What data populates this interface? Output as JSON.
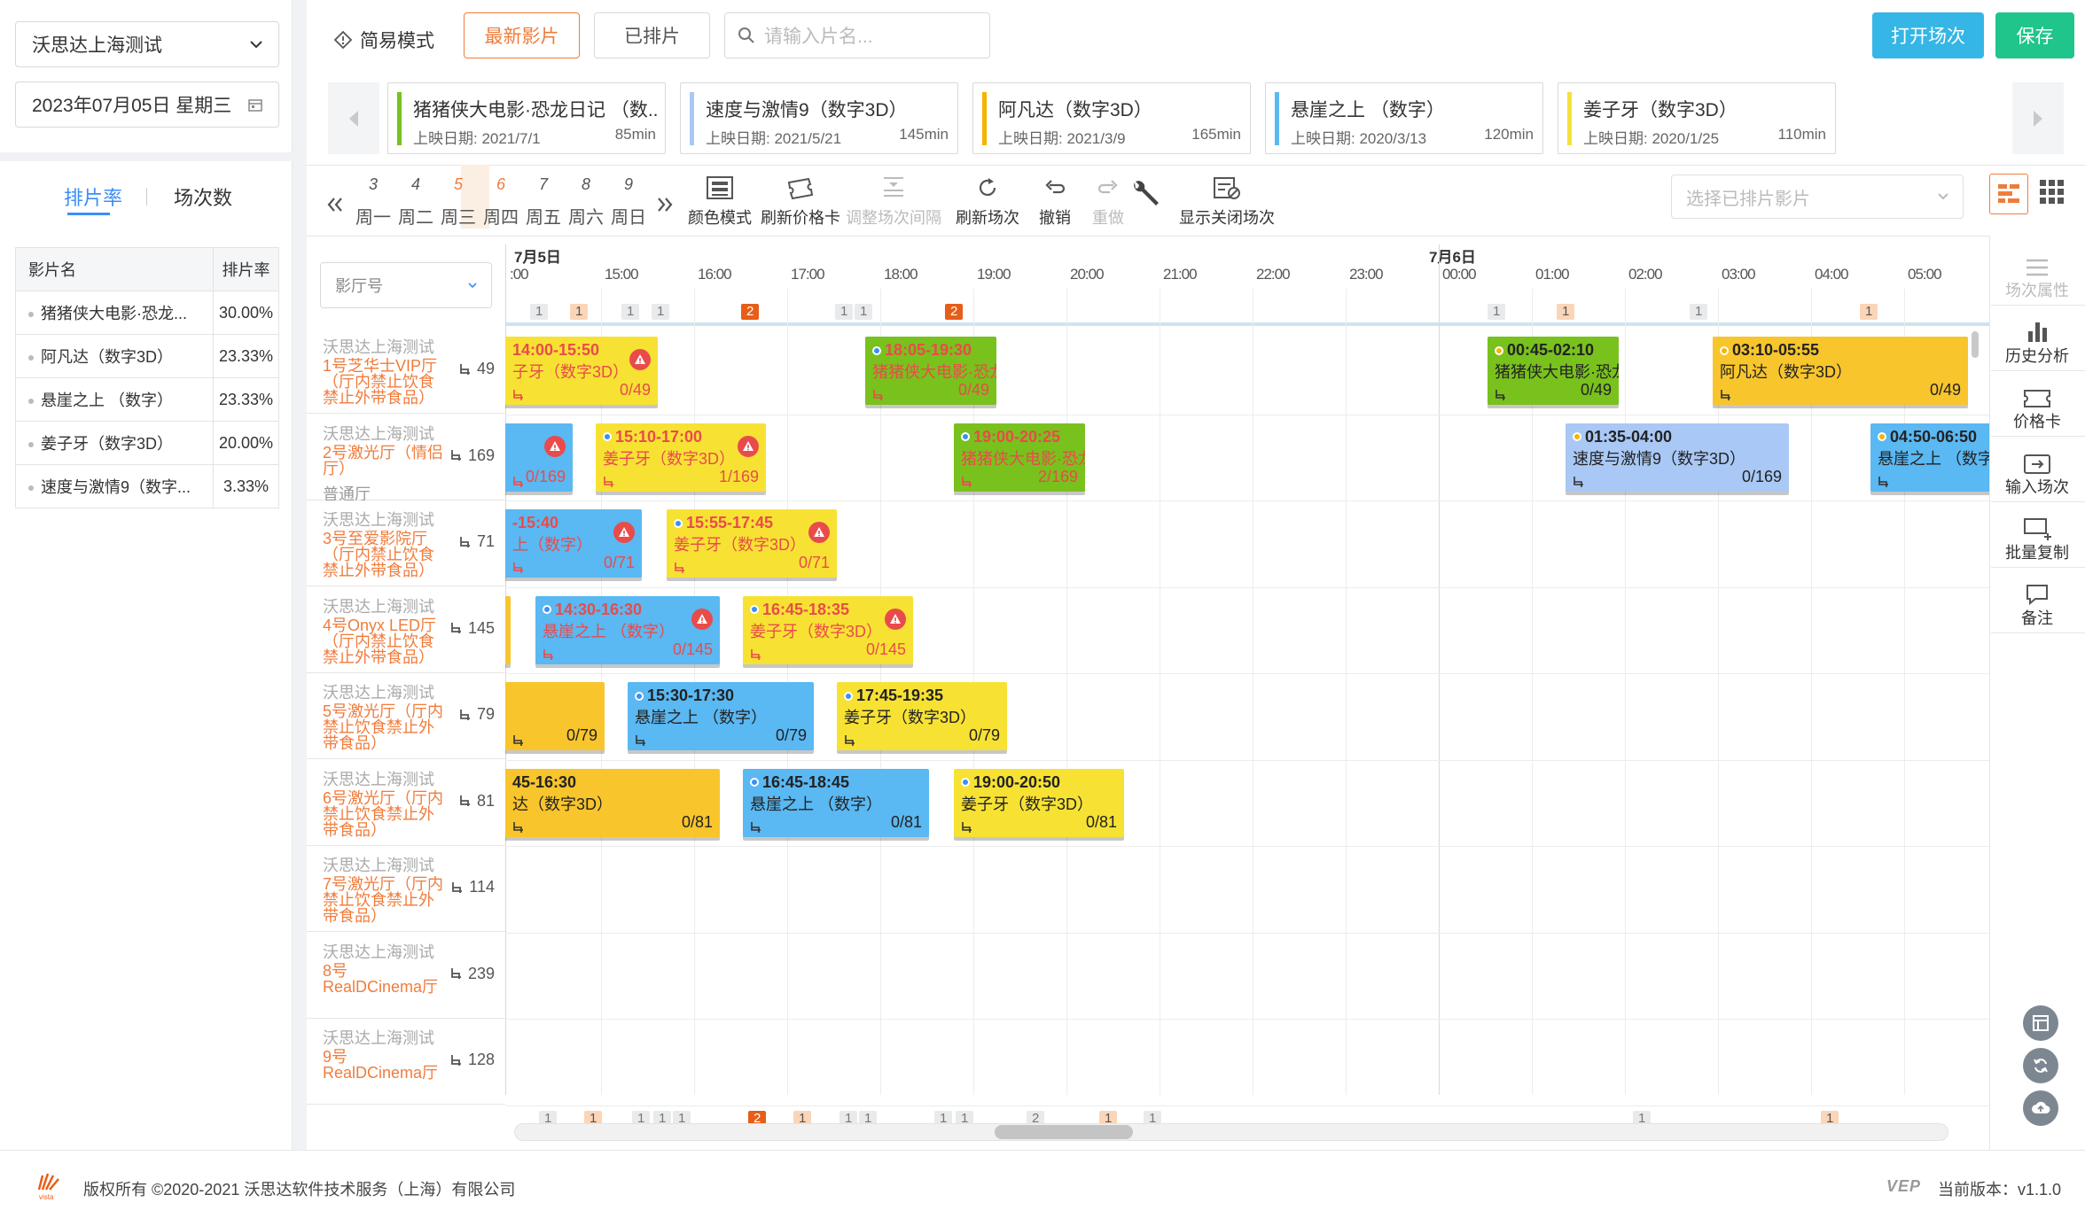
{
  "left": {
    "cinema_select": "沃思达上海测试",
    "date": "2023年07月05日 星期三",
    "tabs": [
      "排片率",
      "场次数"
    ],
    "table_headers": [
      "影片名",
      "排片率"
    ],
    "rates": [
      {
        "name": "猪猪侠大电影·恐龙...",
        "rate": "30.00%"
      },
      {
        "name": "阿凡达（数字3D）",
        "rate": "23.33%"
      },
      {
        "name": "悬崖之上 （数字）",
        "rate": "23.33%"
      },
      {
        "name": "姜子牙（数字3D）",
        "rate": "20.00%"
      },
      {
        "name": "速度与激情9（数字...",
        "rate": "3.33%"
      }
    ]
  },
  "top": {
    "simple_mode": "简易模式",
    "btn_latest": "最新影片",
    "btn_scheduled": "已排片",
    "search_placeholder": "请输入片名...",
    "btn_open": "打开场次",
    "btn_save": "保存",
    "colors": {
      "open": "#35b6e6",
      "save": "#1fc58a",
      "accent": "#f07c3c"
    }
  },
  "movies": [
    {
      "title": "猪猪侠大电影·恐龙日记 （数...",
      "date": "上映日期: 2021/7/1",
      "mins": "85min",
      "color": "#79c11d"
    },
    {
      "title": "速度与激情9（数字3D）",
      "date": "上映日期: 2021/5/21",
      "mins": "145min",
      "color": "#a9c8f5"
    },
    {
      "title": "阿凡达（数字3D）",
      "date": "上映日期: 2021/3/9",
      "mins": "165min",
      "color": "#f5b400"
    },
    {
      "title": "悬崖之上 （数字）",
      "date": "上映日期: 2020/3/13",
      "mins": "120min",
      "color": "#5ab8f2"
    },
    {
      "title": "姜子牙（数字3D）",
      "date": "上映日期: 2020/1/25",
      "mins": "110min",
      "color": "#f5e23a"
    }
  ],
  "days": [
    {
      "n": "3",
      "w": "周一"
    },
    {
      "n": "4",
      "w": "周二"
    },
    {
      "n": "5",
      "w": "周三"
    },
    {
      "n": "6",
      "w": "周四"
    },
    {
      "n": "7",
      "w": "周五"
    },
    {
      "n": "8",
      "w": "周六"
    },
    {
      "n": "9",
      "w": "周日"
    }
  ],
  "tools": {
    "color_mode": "颜色模式",
    "refresh_price": "刷新价格卡",
    "adjust_gap": "调整场次间隔",
    "refresh_session": "刷新场次",
    "undo": "撤销",
    "redo": "重做",
    "show_closed": "显示关闭场次",
    "select_placeholder": "选择已排片影片"
  },
  "timeline": {
    "date1": "7月5日",
    "date2": "7月6日",
    "hall_filter": "影厅号",
    "times": [
      ":00",
      "15:00",
      "16:00",
      "17:00",
      "18:00",
      "19:00",
      "20:00",
      "21:00",
      "22:00",
      "23:00",
      "00:00",
      "01:00",
      "02:00",
      "03:00",
      "04:00",
      "05:00",
      "0"
    ],
    "top_counts": [
      "1",
      "1",
      "1",
      "1",
      "2",
      "1",
      "1",
      "2",
      "1",
      "1",
      "1",
      "1"
    ],
    "bottom_counts": [
      "1",
      "1",
      "1",
      "1",
      "1",
      "2",
      "1",
      "1",
      "1",
      "1",
      "1",
      "2",
      "1",
      "1",
      "1",
      "1"
    ]
  },
  "halls": [
    {
      "cinema": "沃思达上海测试",
      "name": "1号芝华士VIP厅（厅内禁止饮食禁止外带食品）",
      "seats": "49"
    },
    {
      "cinema": "沃思达上海测试",
      "name": "2号激光厅（情侣厅）",
      "sub": "普通厅",
      "seats": "169"
    },
    {
      "cinema": "沃思达上海测试",
      "name": "3号至爱影院厅（厅内禁止饮食禁止外带食品）",
      "seats": "71"
    },
    {
      "cinema": "沃思达上海测试",
      "name": "4号Onyx LED厅（厅内禁止饮食禁止外带食品）",
      "seats": "145"
    },
    {
      "cinema": "沃思达上海测试",
      "name": "5号激光厅（厅内禁止饮食禁止外带食品）",
      "seats": "79"
    },
    {
      "cinema": "沃思达上海测试",
      "name": "6号激光厅（厅内禁止饮食禁止外带食品）",
      "seats": "81"
    },
    {
      "cinema": "沃思达上海测试",
      "name": "7号激光厅（厅内禁止饮食禁止外带食品）",
      "seats": "114"
    },
    {
      "cinema": "沃思达上海测试",
      "name": "8号RealDCinema厅",
      "seats": "239"
    },
    {
      "cinema": "沃思达上海测试",
      "name": "9号RealDCinema厅",
      "seats": "128"
    }
  ],
  "sessions": [
    {
      "row": 0,
      "time": "14:00-15:50",
      "name": "子牙（数字3D）",
      "occ": "0/49",
      "color": "#f7e234",
      "red": true,
      "warn": true,
      "dot": ""
    },
    {
      "row": 0,
      "time": "18:05-19:30",
      "name": "猪猪侠大电影·恐龙",
      "occ": "0/49",
      "color": "#79c11d",
      "red": true,
      "warn": false,
      "dot": "b"
    },
    {
      "row": 0,
      "time": "00:45-02:10",
      "name": "猪猪侠大电影·恐龙",
      "occ": "0/49",
      "color": "#79c11d",
      "red": false,
      "warn": false,
      "dot": "y"
    },
    {
      "row": 0,
      "time": "03:10-05:55",
      "name": "阿凡达（数字3D）",
      "occ": "0/49",
      "color": "#f8c52c",
      "red": false,
      "warn": false,
      "dot": "y"
    },
    {
      "row": 1,
      "time": "",
      "name": "",
      "occ": "0/169",
      "color": "#5ab8f2",
      "red": true,
      "warn": true,
      "dot": ""
    },
    {
      "row": 1,
      "time": "15:10-17:00",
      "name": "姜子牙（数字3D）",
      "occ": "1/169",
      "color": "#f7e234",
      "red": true,
      "warn": true,
      "dot": "b"
    },
    {
      "row": 1,
      "time": "19:00-20:25",
      "name": "猪猪侠大电影·恐龙",
      "occ": "2/169",
      "color": "#79c11d",
      "red": true,
      "warn": false,
      "dot": "b"
    },
    {
      "row": 1,
      "time": "01:35-04:00",
      "name": "速度与激情9（数字3D）",
      "occ": "0/169",
      "color": "#a9c8f5",
      "red": false,
      "warn": false,
      "dot": "y"
    },
    {
      "row": 1,
      "time": "04:50-06:50",
      "name": "悬崖之上 （数字）",
      "occ": "",
      "color": "#5ab8f2",
      "red": false,
      "warn": false,
      "dot": "y"
    },
    {
      "row": 2,
      "time": "-15:40",
      "name": "上（数字）",
      "occ": "0/71",
      "color": "#5ab8f2",
      "red": true,
      "warn": true,
      "dot": ""
    },
    {
      "row": 2,
      "time": "15:55-17:45",
      "name": "姜子牙（数字3D）",
      "occ": "0/71",
      "color": "#f7e234",
      "red": true,
      "warn": true,
      "dot": "b"
    },
    {
      "row": 3,
      "time": "",
      "name": "",
      "occ": "",
      "color": "#f8c52c",
      "red": false,
      "warn": false,
      "dot": ""
    },
    {
      "row": 3,
      "time": "14:30-16:30",
      "name": "悬崖之上 （数字）",
      "occ": "0/145",
      "color": "#5ab8f2",
      "red": true,
      "warn": true,
      "dot": "b"
    },
    {
      "row": 3,
      "time": "16:45-18:35",
      "name": "姜子牙（数字3D）",
      "occ": "0/145",
      "color": "#f7e234",
      "red": true,
      "warn": true,
      "dot": "b"
    },
    {
      "row": 4,
      "time": "",
      "name": "",
      "occ": "0/79",
      "color": "#f8c52c",
      "red": false,
      "warn": false,
      "dot": ""
    },
    {
      "row": 4,
      "time": "15:30-17:30",
      "name": "悬崖之上 （数字）",
      "occ": "0/79",
      "color": "#5ab8f2",
      "red": false,
      "warn": false,
      "dot": "b"
    },
    {
      "row": 4,
      "time": "17:45-19:35",
      "name": "姜子牙（数字3D）",
      "occ": "0/79",
      "color": "#f7e234",
      "red": false,
      "warn": false,
      "dot": "b"
    },
    {
      "row": 5,
      "time": "45-16:30",
      "name": "达（数字3D）",
      "occ": "0/81",
      "color": "#f8c52c",
      "red": false,
      "warn": false,
      "dot": ""
    },
    {
      "row": 5,
      "time": "16:45-18:45",
      "name": "悬崖之上 （数字）",
      "occ": "0/81",
      "color": "#5ab8f2",
      "red": false,
      "warn": false,
      "dot": "b"
    },
    {
      "row": 5,
      "time": "19:00-20:50",
      "name": "姜子牙（数字3D）",
      "occ": "0/81",
      "color": "#f7e234",
      "red": false,
      "warn": false,
      "dot": "b"
    }
  ],
  "right_panel": [
    "场次属性",
    "历史分析",
    "价格卡",
    "输入场次",
    "批量复制",
    "备注"
  ],
  "footer": {
    "copyright": "版权所有 ©2020-2021 沃思达软件技术服务（上海）有限公司",
    "logo_text": "vista",
    "brand": "VEP",
    "version": "当前版本：v1.1.0"
  }
}
